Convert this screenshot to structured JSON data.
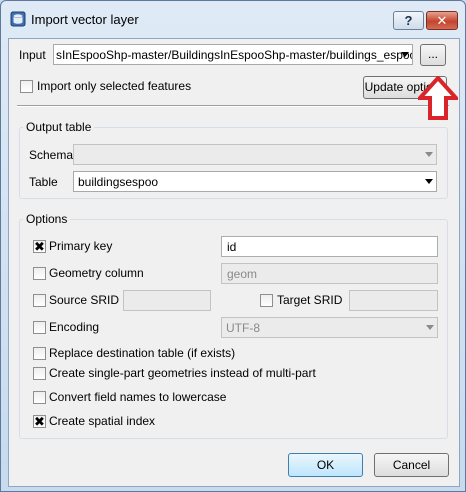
{
  "window": {
    "title": "Import vector layer",
    "help_label": "?",
    "close_label": "✕"
  },
  "input": {
    "label": "Input",
    "value": "sInEspooShp-master/BuildingsInEspooShp-master/buildings_espoo.shp",
    "browse_label": "..."
  },
  "import_selected": {
    "label": "Import only selected features",
    "checked": false
  },
  "update_options_label": "Update options",
  "output_table": {
    "title": "Output table",
    "schema_label": "Schema",
    "schema_value": "",
    "table_label": "Table",
    "table_value": "buildingsespoo"
  },
  "options": {
    "title": "Options",
    "primary_key": {
      "label": "Primary key",
      "checked": true,
      "value": "id"
    },
    "geometry_column": {
      "label": "Geometry column",
      "checked": false,
      "value": "geom"
    },
    "source_srid": {
      "label": "Source SRID",
      "checked": false,
      "value": ""
    },
    "target_srid": {
      "label": "Target SRID",
      "checked": false,
      "value": ""
    },
    "encoding": {
      "label": "Encoding",
      "checked": false,
      "value": "UTF-8"
    },
    "replace_table": {
      "label": "Replace destination table (if exists)",
      "checked": false
    },
    "single_part": {
      "label": "Create single-part geometries instead of multi-part",
      "checked": false
    },
    "lowercase": {
      "label": "Convert field names to lowercase",
      "checked": false
    },
    "spatial_index": {
      "label": "Create spatial index",
      "checked": true
    }
  },
  "buttons": {
    "ok": "OK",
    "cancel": "Cancel"
  },
  "check_mark": "✖",
  "colors": {
    "callout": "#d9252a",
    "accent": "#3c7fb1"
  }
}
